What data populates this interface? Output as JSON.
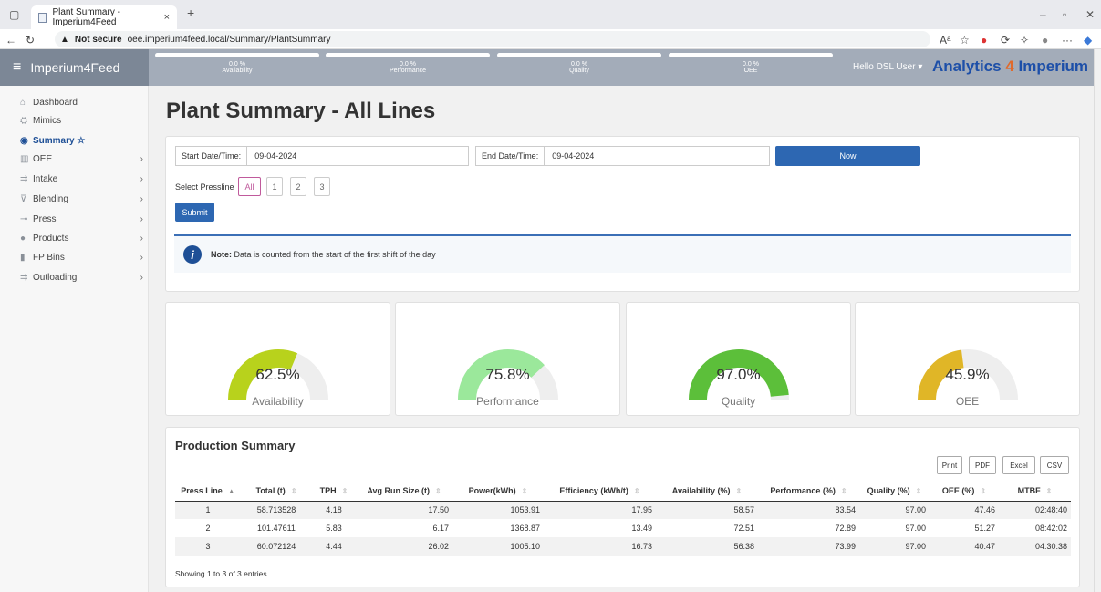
{
  "browser": {
    "tab_title": "Plant Summary - Imperium4Feed",
    "close_glyph": "×",
    "new_tab_glyph": "+",
    "not_secure": "Not secure",
    "url": "oee.imperium4feed.local/Summary/PlantSummary"
  },
  "app": {
    "brand": "Imperium4Feed",
    "kpis": [
      {
        "value": "0.0 %",
        "label": "Availability"
      },
      {
        "value": "0.0 %",
        "label": "Performance"
      },
      {
        "value": "0.0 %",
        "label": "Quality"
      },
      {
        "value": "0.0 %",
        "label": "OEE"
      }
    ],
    "user": "Hello DSL User ▾",
    "logo_a": "Analytics",
    "logo_4": "4",
    "logo_b": "Imperium"
  },
  "sidebar": {
    "items": [
      {
        "label": "Dashboard",
        "icon": "home-icon",
        "glyph": "⌂",
        "arrow": ""
      },
      {
        "label": "Mimics",
        "icon": "mimics-icon",
        "glyph": "⛭",
        "arrow": ""
      },
      {
        "label": "Summary ☆",
        "icon": "eye-icon",
        "glyph": "◉",
        "arrow": ""
      },
      {
        "label": "OEE",
        "icon": "chart-icon",
        "glyph": "▥",
        "arrow": "›"
      },
      {
        "label": "Intake",
        "icon": "intake-icon",
        "glyph": "⇉",
        "arrow": "›"
      },
      {
        "label": "Blending",
        "icon": "funnel-icon",
        "glyph": "⊽",
        "arrow": "›"
      },
      {
        "label": "Press",
        "icon": "press-icon",
        "glyph": "⊸",
        "arrow": "›"
      },
      {
        "label": "Products",
        "icon": "products-icon",
        "glyph": "●",
        "arrow": "›"
      },
      {
        "label": "FP Bins",
        "icon": "bins-icon",
        "glyph": "▮",
        "arrow": "›"
      },
      {
        "label": "Outloading",
        "icon": "outload-icon",
        "glyph": "⇉",
        "arrow": "›"
      }
    ]
  },
  "page": {
    "title": "Plant Summary - All Lines",
    "start_label": "Start Date/Time:",
    "start_value": "09-04-2024",
    "end_label": "End Date/Time:",
    "end_value": "09-04-2024",
    "now_label": "Now",
    "select_label": "Select Pressline",
    "presslines": [
      "All",
      "1",
      "2",
      "3"
    ],
    "submit_label": "Submit",
    "note_bold": "Note:",
    "note_text": " Data is counted from the start of the first shift of the day"
  },
  "gauges": [
    {
      "label": "Availability",
      "value": "62.5%",
      "pct": 62.5,
      "color": "#b8d21c"
    },
    {
      "label": "Performance",
      "value": "75.8%",
      "pct": 75.8,
      "color": "#9be89b"
    },
    {
      "label": "Quality",
      "value": "97.0%",
      "pct": 97.0,
      "color": "#5cbf3a"
    },
    {
      "label": "OEE",
      "value": "45.9%",
      "pct": 45.9,
      "color": "#e0b627"
    }
  ],
  "production": {
    "title": "Production Summary",
    "buttons": [
      "Print",
      "PDF",
      "Excel",
      "CSV"
    ],
    "columns": [
      "Press Line",
      "Total (t)",
      "TPH",
      "Avg Run Size (t)",
      "Power(kWh)",
      "Efficiency (kWh/t)",
      "Availability (%)",
      "Performance (%)",
      "Quality (%)",
      "OEE (%)",
      "MTBF"
    ],
    "rows": [
      [
        "1",
        "58.713528",
        "4.18",
        "17.50",
        "1053.91",
        "17.95",
        "58.57",
        "83.54",
        "97.00",
        "47.46",
        "02:48:40"
      ],
      [
        "2",
        "101.47611",
        "5.83",
        "6.17",
        "1368.87",
        "13.49",
        "72.51",
        "72.89",
        "97.00",
        "51.27",
        "08:42:02"
      ],
      [
        "3",
        "60.072124",
        "4.44",
        "26.02",
        "1005.10",
        "16.73",
        "56.38",
        "73.99",
        "97.00",
        "40.47",
        "04:30:38"
      ]
    ],
    "showing": "Showing 1 to 3 of 3 entries"
  }
}
